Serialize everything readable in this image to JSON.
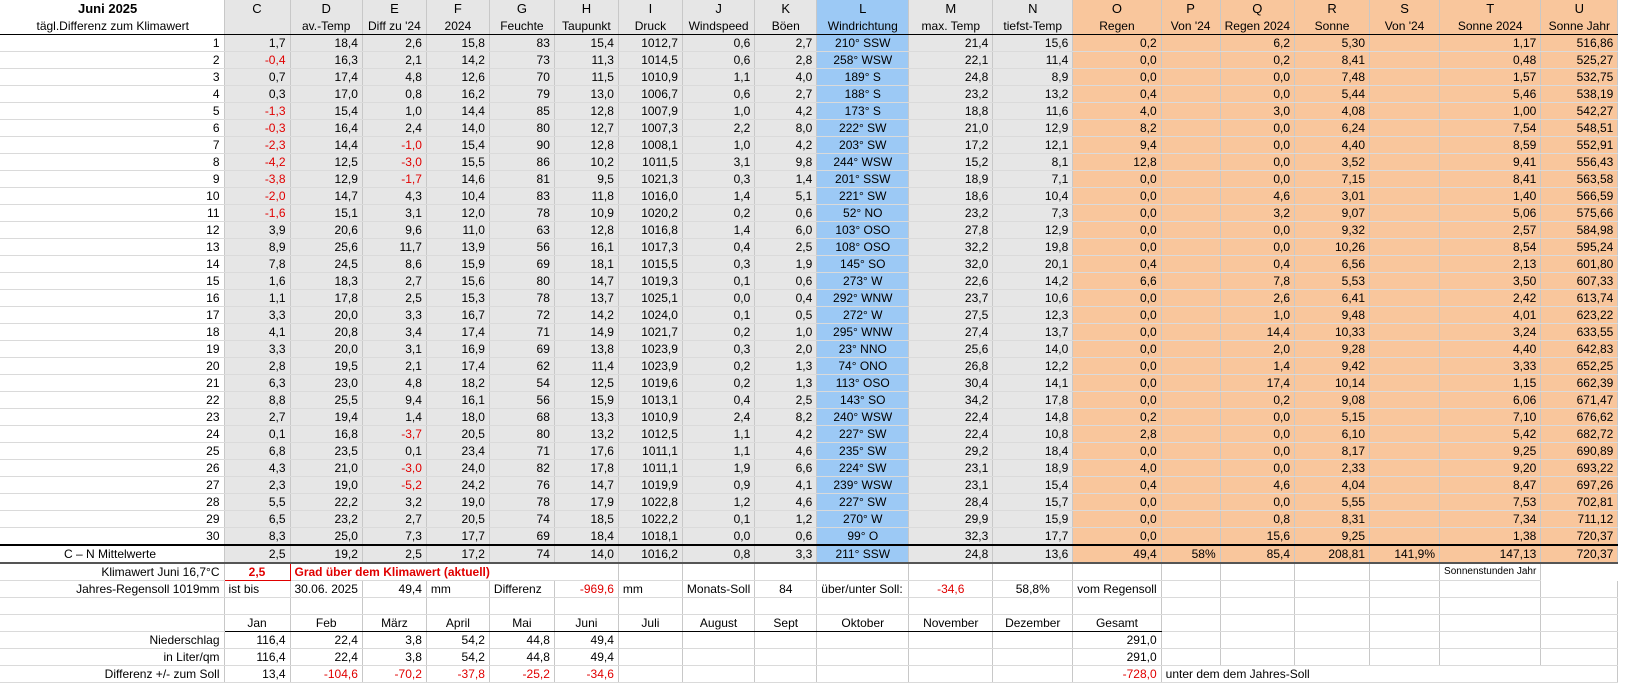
{
  "title": "Juni 2025",
  "col_letters": [
    "C",
    "D",
    "E",
    "F",
    "G",
    "H",
    "I",
    "J",
    "K",
    "L",
    "M",
    "N",
    "O",
    "P",
    "Q",
    "R",
    "S",
    "T",
    "U"
  ],
  "row_label_header": "tägl.Differenz zum Klimawert",
  "col_headers": [
    "",
    "av.-Temp",
    "Diff zu '24",
    "2024",
    "Feuchte",
    "Taupunkt",
    "Druck",
    "Windspeed",
    "Böen",
    "Windrichtung",
    "max. Temp",
    "tiefst-Temp",
    "Regen",
    "Von '24",
    "Regen 2024",
    "Sonne",
    "Von '24",
    "Sonne 2024",
    "Sonne Jahr"
  ],
  "days": [
    [
      "1",
      "1,7",
      "18,4",
      "2,6",
      "15,8",
      "83",
      "15,4",
      "1012,7",
      "0,6",
      "2,7",
      "210° SSW",
      "21,4",
      "15,6",
      "0,2",
      "",
      "6,2",
      "5,30",
      "",
      "1,17",
      "516,86"
    ],
    [
      "2",
      "-0,4",
      "16,3",
      "2,1",
      "14,2",
      "73",
      "11,3",
      "1014,5",
      "0,6",
      "2,8",
      "258° WSW",
      "22,1",
      "11,4",
      "0,0",
      "",
      "0,2",
      "8,41",
      "",
      "0,48",
      "525,27"
    ],
    [
      "3",
      "0,7",
      "17,4",
      "4,8",
      "12,6",
      "70",
      "11,5",
      "1010,9",
      "1,1",
      "4,0",
      "189° S",
      "24,8",
      "8,9",
      "0,0",
      "",
      "0,0",
      "7,48",
      "",
      "1,57",
      "532,75"
    ],
    [
      "4",
      "0,3",
      "17,0",
      "0,8",
      "16,2",
      "79",
      "13,0",
      "1006,7",
      "0,6",
      "2,7",
      "188° S",
      "23,2",
      "13,2",
      "0,4",
      "",
      "0,0",
      "5,44",
      "",
      "5,46",
      "538,19"
    ],
    [
      "5",
      "-1,3",
      "15,4",
      "1,0",
      "14,4",
      "85",
      "12,8",
      "1007,9",
      "1,0",
      "4,2",
      "173° S",
      "18,8",
      "11,6",
      "4,0",
      "",
      "3,0",
      "4,08",
      "",
      "1,00",
      "542,27"
    ],
    [
      "6",
      "-0,3",
      "16,4",
      "2,4",
      "14,0",
      "80",
      "12,7",
      "1007,3",
      "2,2",
      "8,0",
      "222° SW",
      "21,0",
      "12,9",
      "8,2",
      "",
      "0,0",
      "6,24",
      "",
      "7,54",
      "548,51"
    ],
    [
      "7",
      "-2,3",
      "14,4",
      "-1,0",
      "15,4",
      "90",
      "12,8",
      "1008,1",
      "1,0",
      "4,2",
      "203° SW",
      "17,2",
      "12,1",
      "9,4",
      "",
      "0,0",
      "4,40",
      "",
      "8,59",
      "552,91"
    ],
    [
      "8",
      "-4,2",
      "12,5",
      "-3,0",
      "15,5",
      "86",
      "10,2",
      "1011,5",
      "3,1",
      "9,8",
      "244° WSW",
      "15,2",
      "8,1",
      "12,8",
      "",
      "0,0",
      "3,52",
      "",
      "9,41",
      "556,43"
    ],
    [
      "9",
      "-3,8",
      "12,9",
      "-1,7",
      "14,6",
      "81",
      "9,5",
      "1021,3",
      "0,3",
      "1,4",
      "201° SSW",
      "18,9",
      "7,1",
      "0,0",
      "",
      "0,0",
      "7,15",
      "",
      "8,41",
      "563,58"
    ],
    [
      "10",
      "-2,0",
      "14,7",
      "4,3",
      "10,4",
      "83",
      "11,8",
      "1016,0",
      "1,4",
      "5,1",
      "221° SW",
      "18,6",
      "10,4",
      "0,0",
      "",
      "4,6",
      "3,01",
      "",
      "1,40",
      "566,59"
    ],
    [
      "11",
      "-1,6",
      "15,1",
      "3,1",
      "12,0",
      "78",
      "10,9",
      "1020,2",
      "0,2",
      "0,6",
      "52° NO",
      "23,2",
      "7,3",
      "0,0",
      "",
      "3,2",
      "9,07",
      "",
      "5,06",
      "575,66"
    ],
    [
      "12",
      "3,9",
      "20,6",
      "9,6",
      "11,0",
      "63",
      "12,8",
      "1016,8",
      "1,4",
      "6,0",
      "103° OSO",
      "27,8",
      "12,9",
      "0,0",
      "",
      "0,0",
      "9,32",
      "",
      "2,57",
      "584,98"
    ],
    [
      "13",
      "8,9",
      "25,6",
      "11,7",
      "13,9",
      "56",
      "16,1",
      "1017,3",
      "0,4",
      "2,5",
      "108° OSO",
      "32,2",
      "19,8",
      "0,0",
      "",
      "0,0",
      "10,26",
      "",
      "8,54",
      "595,24"
    ],
    [
      "14",
      "7,8",
      "24,5",
      "8,6",
      "15,9",
      "69",
      "18,1",
      "1015,5",
      "0,3",
      "1,9",
      "145° SO",
      "32,0",
      "20,1",
      "0,4",
      "",
      "0,4",
      "6,56",
      "",
      "2,13",
      "601,80"
    ],
    [
      "15",
      "1,6",
      "18,3",
      "2,7",
      "15,6",
      "80",
      "14,7",
      "1019,3",
      "0,1",
      "0,6",
      "273° W",
      "22,6",
      "14,2",
      "6,6",
      "",
      "7,8",
      "5,53",
      "",
      "3,50",
      "607,33"
    ],
    [
      "16",
      "1,1",
      "17,8",
      "2,5",
      "15,3",
      "78",
      "13,7",
      "1025,1",
      "0,0",
      "0,4",
      "292° WNW",
      "23,7",
      "10,6",
      "0,0",
      "",
      "2,6",
      "6,41",
      "",
      "2,42",
      "613,74"
    ],
    [
      "17",
      "3,3",
      "20,0",
      "3,3",
      "16,7",
      "72",
      "14,2",
      "1024,0",
      "0,1",
      "0,5",
      "272° W",
      "27,5",
      "12,3",
      "0,0",
      "",
      "1,0",
      "9,48",
      "",
      "4,01",
      "623,22"
    ],
    [
      "18",
      "4,1",
      "20,8",
      "3,4",
      "17,4",
      "71",
      "14,9",
      "1021,7",
      "0,2",
      "1,0",
      "295° WNW",
      "27,4",
      "13,7",
      "0,0",
      "",
      "14,4",
      "10,33",
      "",
      "3,24",
      "633,55"
    ],
    [
      "19",
      "3,3",
      "20,0",
      "3,1",
      "16,9",
      "69",
      "13,8",
      "1023,9",
      "0,3",
      "2,0",
      "23° NNO",
      "25,6",
      "14,0",
      "0,0",
      "",
      "2,0",
      "9,28",
      "",
      "4,40",
      "642,83"
    ],
    [
      "20",
      "2,8",
      "19,5",
      "2,1",
      "17,4",
      "62",
      "11,4",
      "1023,9",
      "0,2",
      "1,3",
      "74° ONO",
      "26,8",
      "12,2",
      "0,0",
      "",
      "1,4",
      "9,42",
      "",
      "3,33",
      "652,25"
    ],
    [
      "21",
      "6,3",
      "23,0",
      "4,8",
      "18,2",
      "54",
      "12,5",
      "1019,6",
      "0,2",
      "1,3",
      "113° OSO",
      "30,4",
      "14,1",
      "0,0",
      "",
      "17,4",
      "10,14",
      "",
      "1,15",
      "662,39"
    ],
    [
      "22",
      "8,8",
      "25,5",
      "9,4",
      "16,1",
      "56",
      "15,9",
      "1013,1",
      "0,4",
      "2,5",
      "143° SO",
      "34,2",
      "17,8",
      "0,0",
      "",
      "0,2",
      "9,08",
      "",
      "6,06",
      "671,47"
    ],
    [
      "23",
      "2,7",
      "19,4",
      "1,4",
      "18,0",
      "68",
      "13,3",
      "1010,9",
      "2,4",
      "8,2",
      "240° WSW",
      "22,4",
      "14,8",
      "0,2",
      "",
      "0,0",
      "5,15",
      "",
      "7,10",
      "676,62"
    ],
    [
      "24",
      "0,1",
      "16,8",
      "-3,7",
      "20,5",
      "80",
      "13,2",
      "1012,5",
      "1,1",
      "4,2",
      "227° SW",
      "22,4",
      "10,8",
      "2,8",
      "",
      "0,0",
      "6,10",
      "",
      "5,42",
      "682,72"
    ],
    [
      "25",
      "6,8",
      "23,5",
      "0,1",
      "23,4",
      "71",
      "17,6",
      "1011,1",
      "1,1",
      "4,6",
      "235° SW",
      "29,2",
      "18,4",
      "0,0",
      "",
      "0,0",
      "8,17",
      "",
      "9,25",
      "690,89"
    ],
    [
      "26",
      "4,3",
      "21,0",
      "-3,0",
      "24,0",
      "82",
      "17,8",
      "1011,1",
      "1,9",
      "6,6",
      "224° SW",
      "23,1",
      "18,9",
      "4,0",
      "",
      "0,0",
      "2,33",
      "",
      "9,20",
      "693,22"
    ],
    [
      "27",
      "2,3",
      "19,0",
      "-5,2",
      "24,2",
      "76",
      "14,7",
      "1019,9",
      "0,9",
      "4,1",
      "239° WSW",
      "23,1",
      "15,4",
      "0,4",
      "",
      "4,6",
      "4,04",
      "",
      "8,47",
      "697,26"
    ],
    [
      "28",
      "5,5",
      "22,2",
      "3,2",
      "19,0",
      "78",
      "17,9",
      "1022,8",
      "1,2",
      "4,6",
      "227° SW",
      "28,4",
      "15,7",
      "0,0",
      "",
      "0,0",
      "5,55",
      "",
      "7,53",
      "702,81"
    ],
    [
      "29",
      "6,5",
      "23,2",
      "2,7",
      "20,5",
      "74",
      "18,5",
      "1022,2",
      "0,1",
      "1,2",
      "270° W",
      "29,9",
      "15,9",
      "0,0",
      "",
      "0,8",
      "8,31",
      "",
      "7,34",
      "711,12"
    ],
    [
      "30",
      "8,3",
      "25,0",
      "7,3",
      "17,7",
      "69",
      "18,4",
      "1018,1",
      "0,0",
      "0,6",
      "99° O",
      "32,3",
      "17,7",
      "0,0",
      "",
      "15,6",
      "9,25",
      "",
      "1,38",
      "720,37"
    ]
  ],
  "summary": {
    "label": "C – N Mittelwerte",
    "values": [
      "2,5",
      "19,2",
      "2,5",
      "17,2",
      "74",
      "14,0",
      "1016,2",
      "0,8",
      "3,3",
      "211° SSW",
      "24,8",
      "13,6",
      "49,4",
      "58%",
      "85,4",
      "208,81",
      "141,9%",
      "147,13",
      "720,37"
    ]
  },
  "klima": {
    "label": "Klimawert Juni 16,7°C",
    "value": "2,5",
    "text": "Grad über dem Klimawert (aktuell)",
    "sonnen_note": "Sonnenstunden Jahr"
  },
  "regen": {
    "label": "Jahres-Regensoll 1019mm",
    "ist_bis": "ist bis",
    "date": "30.06. 2025",
    "ist_value": "49,4",
    "unit": "mm",
    "differenz_label": "Differenz",
    "differenz_value": "-969,6",
    "differenz_unit": "mm",
    "monats_soll_label": "Monats-Soll",
    "monats_soll_value": "84",
    "ueber_unter_label": "über/unter Soll:",
    "ueber_unter_value": "-34,6",
    "percent": "58,8%",
    "percent_text": "vom Regensoll"
  },
  "months": [
    "Jan",
    "Feb",
    "März",
    "April",
    "Mai",
    "Juni",
    "Juli",
    "August",
    "Sept",
    "Oktober",
    "November",
    "Dezember",
    "Gesamt"
  ],
  "niederschlag": {
    "label": "Niederschlag",
    "values": [
      "116,4",
      "22,4",
      "3,8",
      "54,2",
      "44,8",
      "49,4",
      "",
      "",
      "",
      "",
      "",
      "",
      "291,0"
    ]
  },
  "liter": {
    "label": "in Liter/qm",
    "values": [
      "116,4",
      "22,4",
      "3,8",
      "54,2",
      "44,8",
      "49,4",
      "",
      "",
      "",
      "",
      "",
      "",
      "291,0"
    ]
  },
  "differenz_soll": {
    "label": "Differenz  +/- zum Soll",
    "values": [
      "13,4",
      "-104,6",
      "-70,2",
      "-37,8",
      "-25,2",
      "-34,6",
      "",
      "",
      "",
      "",
      "",
      "",
      "-728,0"
    ],
    "note": "unter dem dem Jahres-Soll"
  },
  "colors": {
    "gray": "#e6e6e6",
    "blue": "#9cc9f5",
    "orange": "#f9c69c",
    "negative": "#e00000"
  }
}
